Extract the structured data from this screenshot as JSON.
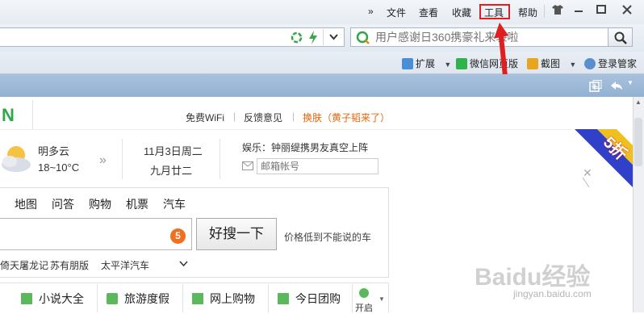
{
  "menubar": {
    "more": "»",
    "items": [
      "文件",
      "查看",
      "收藏",
      "工具",
      "帮助"
    ],
    "highlight_color": "#e02020",
    "window_buttons": [
      "shirt-icon",
      "minimize-icon",
      "maximize-icon",
      "close-icon"
    ]
  },
  "search": {
    "placeholder": "用户感谢日360携豪礼来袭啦"
  },
  "toolbar": {
    "items": [
      "扩展",
      "微信网页版",
      "截图",
      "登录管家"
    ]
  },
  "page": {
    "logo": "N",
    "top_links": [
      "免费WiFi",
      "反馈意见",
      "换肤（黄子韬来了）"
    ],
    "skin_color": "#e8650a",
    "weather": {
      "desc": "明多云",
      "temp": "18~10°C"
    },
    "date": {
      "solar": "11月3日周二",
      "lunar": "九月廿二"
    },
    "news": "娱乐：钟丽缇携男友真空上阵",
    "mail_placeholder": "邮箱帐号",
    "promo": {
      "badge": "5折"
    },
    "nav": [
      "地图",
      "问答",
      "购物",
      "机票",
      "汽车"
    ],
    "search_badge": "5",
    "search_button": "好搜一下",
    "search_hint": "价格低到不能说的车",
    "hot_links": [
      "倚天屠龙记",
      "苏有朋版",
      "太平洋汽车"
    ],
    "categories": [
      "小说大全",
      "旅游度假",
      "网上购物",
      "今日团购"
    ],
    "open_label": "开启"
  },
  "watermark": {
    "brand": "Baidu经验",
    "url": "jingyan.baidu.com"
  }
}
